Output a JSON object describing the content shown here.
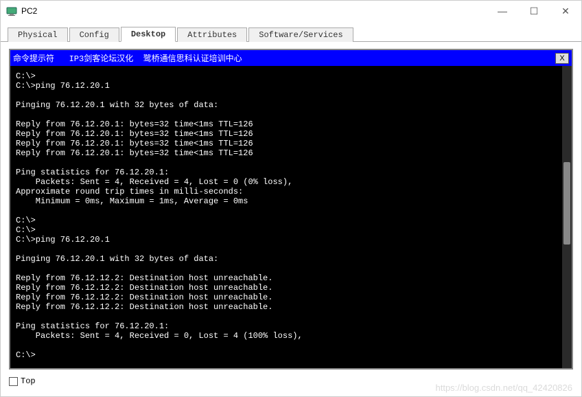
{
  "window": {
    "title": "PC2",
    "min": "—",
    "max": "☐",
    "close": "✕"
  },
  "tabs": {
    "physical": "Physical",
    "config": "Config",
    "desktop": "Desktop",
    "attributes": "Attributes",
    "software": "Software/Services"
  },
  "terminal": {
    "title": "命令提示符   IP3剑客论坛汉化  鹭桥通信思科认证培训中心",
    "close": "X",
    "lines": [
      "C:\\>",
      "C:\\>ping 76.12.20.1",
      "",
      "Pinging 76.12.20.1 with 32 bytes of data:",
      "",
      "Reply from 76.12.20.1: bytes=32 time<1ms TTL=126",
      "Reply from 76.12.20.1: bytes=32 time<1ms TTL=126",
      "Reply from 76.12.20.1: bytes=32 time<1ms TTL=126",
      "Reply from 76.12.20.1: bytes=32 time<1ms TTL=126",
      "",
      "Ping statistics for 76.12.20.1:",
      "    Packets: Sent = 4, Received = 4, Lost = 0 (0% loss),",
      "Approximate round trip times in milli-seconds:",
      "    Minimum = 0ms, Maximum = 1ms, Average = 0ms",
      "",
      "C:\\>",
      "C:\\>",
      "C:\\>ping 76.12.20.1",
      "",
      "Pinging 76.12.20.1 with 32 bytes of data:",
      "",
      "Reply from 76.12.12.2: Destination host unreachable.",
      "Reply from 76.12.12.2: Destination host unreachable.",
      "Reply from 76.12.12.2: Destination host unreachable.",
      "Reply from 76.12.12.2: Destination host unreachable.",
      "",
      "Ping statistics for 76.12.20.1:",
      "    Packets: Sent = 4, Received = 0, Lost = 4 (100% loss),",
      "",
      "C:\\>"
    ]
  },
  "footer": {
    "top_label": "Top"
  },
  "watermark": "https://blog.csdn.net/qq_42420826"
}
